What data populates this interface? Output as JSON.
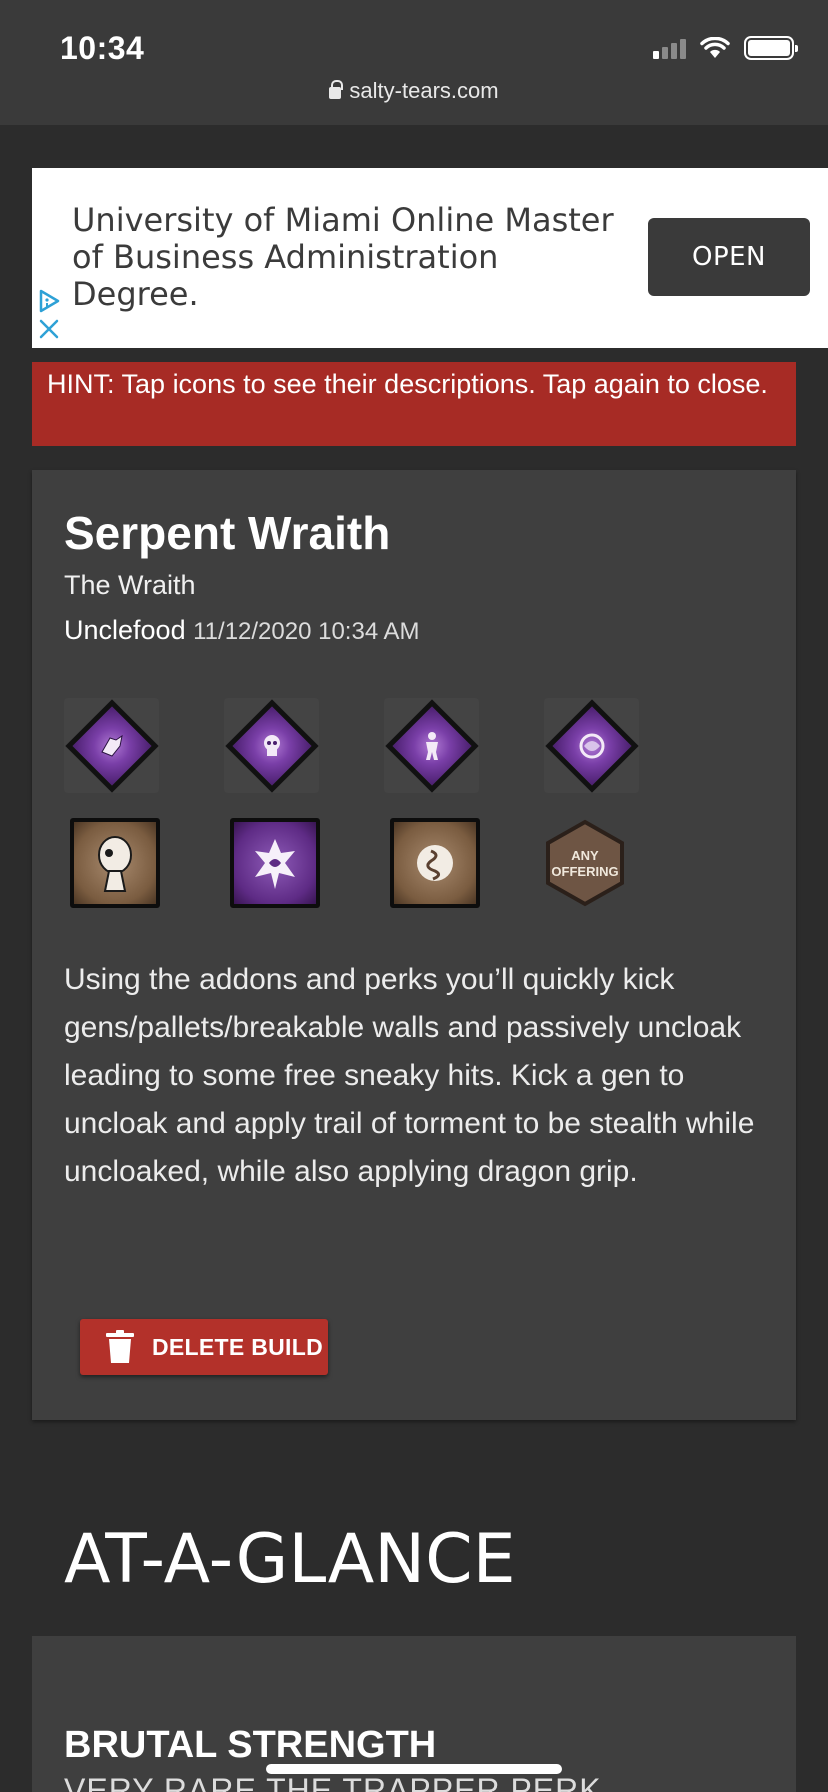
{
  "status_bar": {
    "time": "10:34"
  },
  "browser": {
    "url": "salty-tears.com"
  },
  "ad": {
    "text": "University of Miami Online Master of Business Administration Degree.",
    "button_label": "OPEN"
  },
  "hint": {
    "text": "HINT: Tap icons to see their descriptions. Tap again to close."
  },
  "build": {
    "title": "Serpent Wraith",
    "killer": "The Wraith",
    "author": "Unclefood",
    "date": "11/12/2020 10:34 AM",
    "perks": [
      {
        "icon": "perk-icon-1"
      },
      {
        "icon": "perk-icon-2"
      },
      {
        "icon": "perk-icon-3"
      },
      {
        "icon": "perk-icon-4"
      }
    ],
    "addons": [
      {
        "icon": "addon-icon-1",
        "rarity_color": "#7a5c40"
      },
      {
        "icon": "addon-icon-2",
        "rarity_color": "#5e2b85"
      },
      {
        "icon": "addon-icon-3",
        "rarity_color": "#7a5c40"
      }
    ],
    "offering": {
      "line1": "ANY",
      "line2": "OFFERING"
    },
    "description": "Using the addons and perks you’ll quickly kick gens/pallets/breakable walls and passively uncloak leading to some free sneaky hits. Kick a gen to uncloak and apply trail of torment to be stealth while uncloaked, while also applying dragon grip.",
    "delete_label": "DELETE BUILD"
  },
  "glance": {
    "heading": "AT-A-GLANCE",
    "first_perk_name": "BRUTAL STRENGTH",
    "first_perk_sub": "VERY RARE THE TRAPPER PERK"
  },
  "colors": {
    "hint_bg": "#a72b25",
    "delete_bg": "#b3312a",
    "card_bg": "#3f3f3f",
    "page_bg": "#2c2c2c"
  }
}
